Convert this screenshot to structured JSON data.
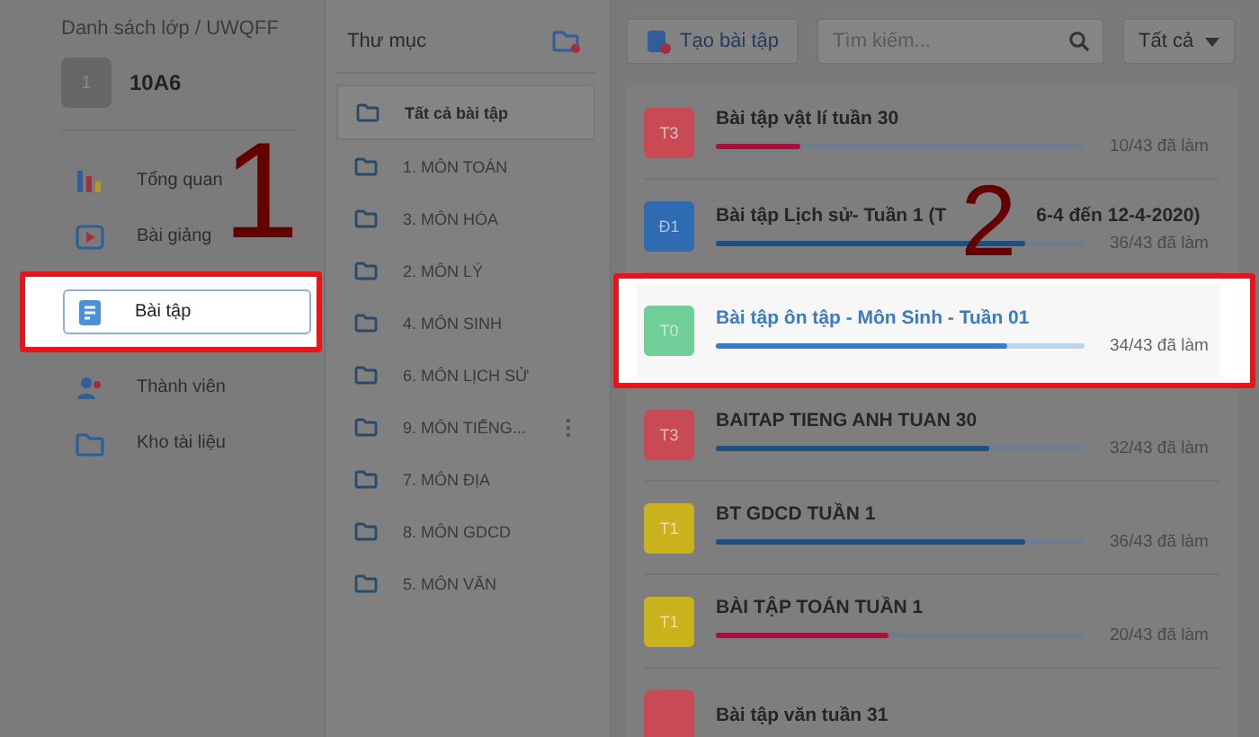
{
  "breadcrumb": "Danh sách lớp / UWQFF",
  "class": {
    "avatar": "1",
    "name": "10A6"
  },
  "nav": [
    {
      "kind": "chart",
      "label": "Tổng quan",
      "selected": false
    },
    {
      "kind": "play",
      "label": "Bài giảng",
      "selected": false
    },
    {
      "kind": "doc",
      "label": "Bài tập",
      "selected": true,
      "framed": true
    },
    {
      "kind": "people",
      "label": "Thành viên",
      "selected": false
    },
    {
      "kind": "folder",
      "label": "Kho tài liệu",
      "selected": false
    }
  ],
  "nav_annotation": "1",
  "folders": {
    "title": "Thư mục",
    "items": [
      {
        "label": "Tất cả bài tập",
        "selected": true,
        "menu": false
      },
      {
        "label": "1. MÔN TOÁN",
        "selected": false,
        "menu": false
      },
      {
        "label": "3. MÔN HÓA",
        "selected": false,
        "menu": false
      },
      {
        "label": "2. MÔN LÝ",
        "selected": false,
        "menu": false
      },
      {
        "label": "4. MÔN SINH",
        "selected": false,
        "menu": false
      },
      {
        "label": "6. MÔN LỊCH SỬ",
        "selected": false,
        "menu": false
      },
      {
        "label": "9. MÔN TIẾNG...",
        "selected": false,
        "menu": true
      },
      {
        "label": "7. MÔN ĐỊA",
        "selected": false,
        "menu": false
      },
      {
        "label": "8. MÔN GDCD",
        "selected": false,
        "menu": false
      },
      {
        "label": "5. MÔN VĂN",
        "selected": false,
        "menu": false
      }
    ]
  },
  "toolbar": {
    "create": "Tạo bài tập",
    "search_placeholder": "Tìm kiếm...",
    "filter": "Tất cả"
  },
  "assignments": [
    {
      "badge": "T3",
      "color": "#c84a55",
      "title": "Bài tập vật lí tuần 30",
      "progress": {
        "level": 0.23,
        "color": "#a8103c"
      },
      "reading": "10/43 đã làm",
      "highlighted": false
    },
    {
      "badge": "Đ1",
      "color": "#2f6bb0",
      "title_parts": [
        "Bài tập Lịch sử- Tuần 1 (T",
        "6-4 đến 12-4-2020)"
      ],
      "annotation": "2",
      "progress": {
        "level": 0.84,
        "color": "#1f4e80"
      },
      "reading": "36/43 đã làm",
      "highlighted": false
    },
    {
      "badge": "T0",
      "color": "#6fcf97",
      "title": "Bài tập ôn tập - Môn Sinh - Tuần 01",
      "progress": {
        "level": 0.79,
        "color": "#3a7bc8"
      },
      "reading": "34/43 đã làm",
      "highlighted": true
    },
    {
      "badge": "T3",
      "color": "#c84a55",
      "title": "BAITAP TIENG ANH TUAN 30",
      "progress": {
        "level": 0.74,
        "color": "#1f4e80"
      },
      "reading": "32/43 đã làm",
      "highlighted": false
    },
    {
      "badge": "T1",
      "color": "#c9b21c",
      "title": "BT GDCD TUẦN 1",
      "progress": {
        "level": 0.84,
        "color": "#1f4e80"
      },
      "reading": "36/43 đã làm",
      "highlighted": false
    },
    {
      "badge": "T1",
      "color": "#c9b21c",
      "title": "BÀI TẬP TOÁN TUẦN 1",
      "progress": {
        "level": 0.47,
        "color": "#a8103c"
      },
      "reading": "20/43 đã làm",
      "highlighted": false
    },
    {
      "color": "#c84a55",
      "title": "Bài tập văn tuần 31",
      "highlighted": false
    }
  ]
}
